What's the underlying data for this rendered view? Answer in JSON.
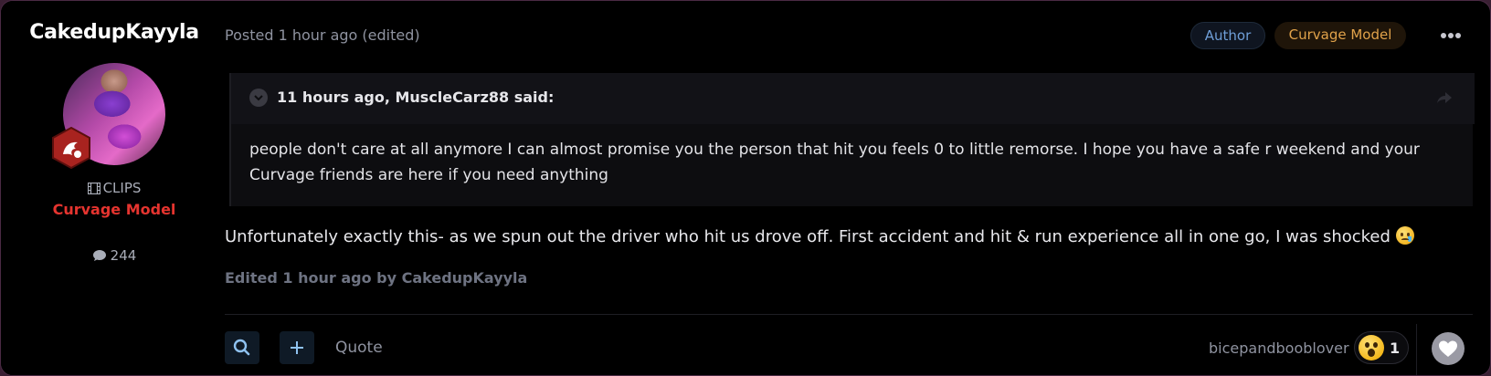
{
  "author": {
    "name": "CakedupKayyla",
    "group_label": "CLIPS",
    "role": "Curvage Model",
    "post_count": "244"
  },
  "post": {
    "posted": "Posted 1 hour ago (edited)",
    "badges": {
      "author": "Author",
      "model": "Curvage Model"
    },
    "quote": {
      "citation": "11 hours ago, MuscleCarz88 said:",
      "text": " people don't care at all anymore I can almost promise you the person that hit you feels 0 to little remorse. I hope you have a safe r weekend and your Curvage friends are here if you need anything"
    },
    "body": "Unfortunately exactly this- as we spun out the driver who hit us drove off. First accident and hit & run experience all in one go, I was shocked",
    "edited_note": "Edited 1 hour ago by CakedupKayyla"
  },
  "footer": {
    "quote_label": "Quote",
    "reactor_name": "bicepandbooblover",
    "reaction_count": "1"
  },
  "colors": {
    "background": "#000000",
    "role_red": "#e5342f",
    "author_badge_text": "#6f9fd8",
    "model_badge_text": "#e0a24a",
    "muted": "#8f93a0"
  },
  "icons": [
    "film-icon",
    "comment-icon",
    "more-icon",
    "chevron-down-icon",
    "share-icon",
    "search-icon",
    "plus-icon",
    "wow-emoji-icon",
    "heart-icon",
    "sad-tear-emoji-icon",
    "rank-badge-icon"
  ]
}
